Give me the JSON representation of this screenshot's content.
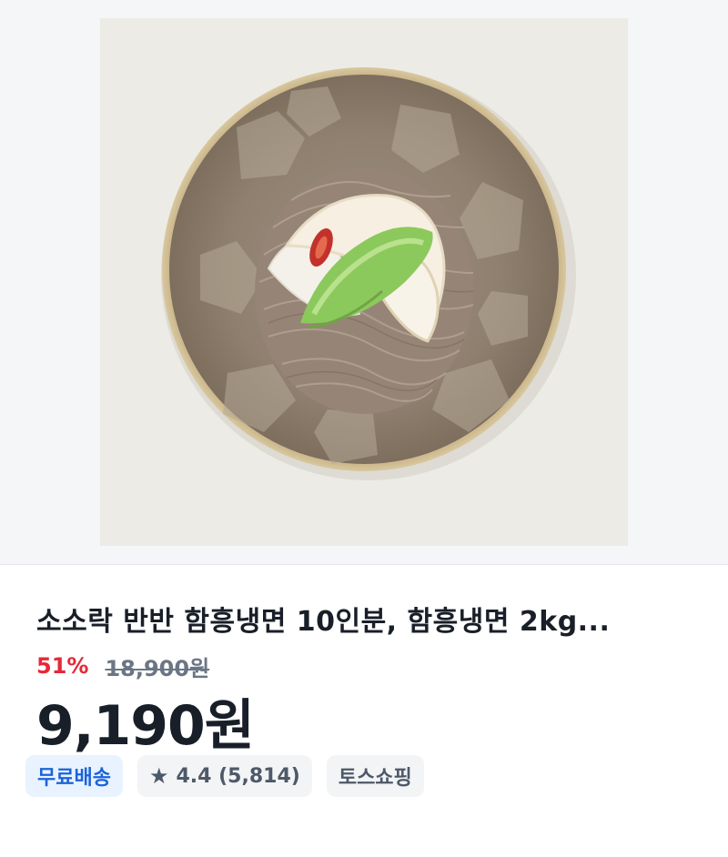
{
  "product": {
    "title": "소소락 반반 함흥냉면 10인분, 함흥냉면 2kg...",
    "discount_rate": "51%",
    "original_price": "18,900원",
    "sale_price": "9,190원"
  },
  "badges": {
    "shipping": "무료배송",
    "rating": "4.4 (5,814)",
    "seller": "토스쇼핑"
  },
  "icons": {
    "rating_icon": "star-icon"
  },
  "colors": {
    "discount": "#e42939",
    "free_shipping": "#1b64da",
    "free_shipping_bg": "#e8f3ff"
  }
}
